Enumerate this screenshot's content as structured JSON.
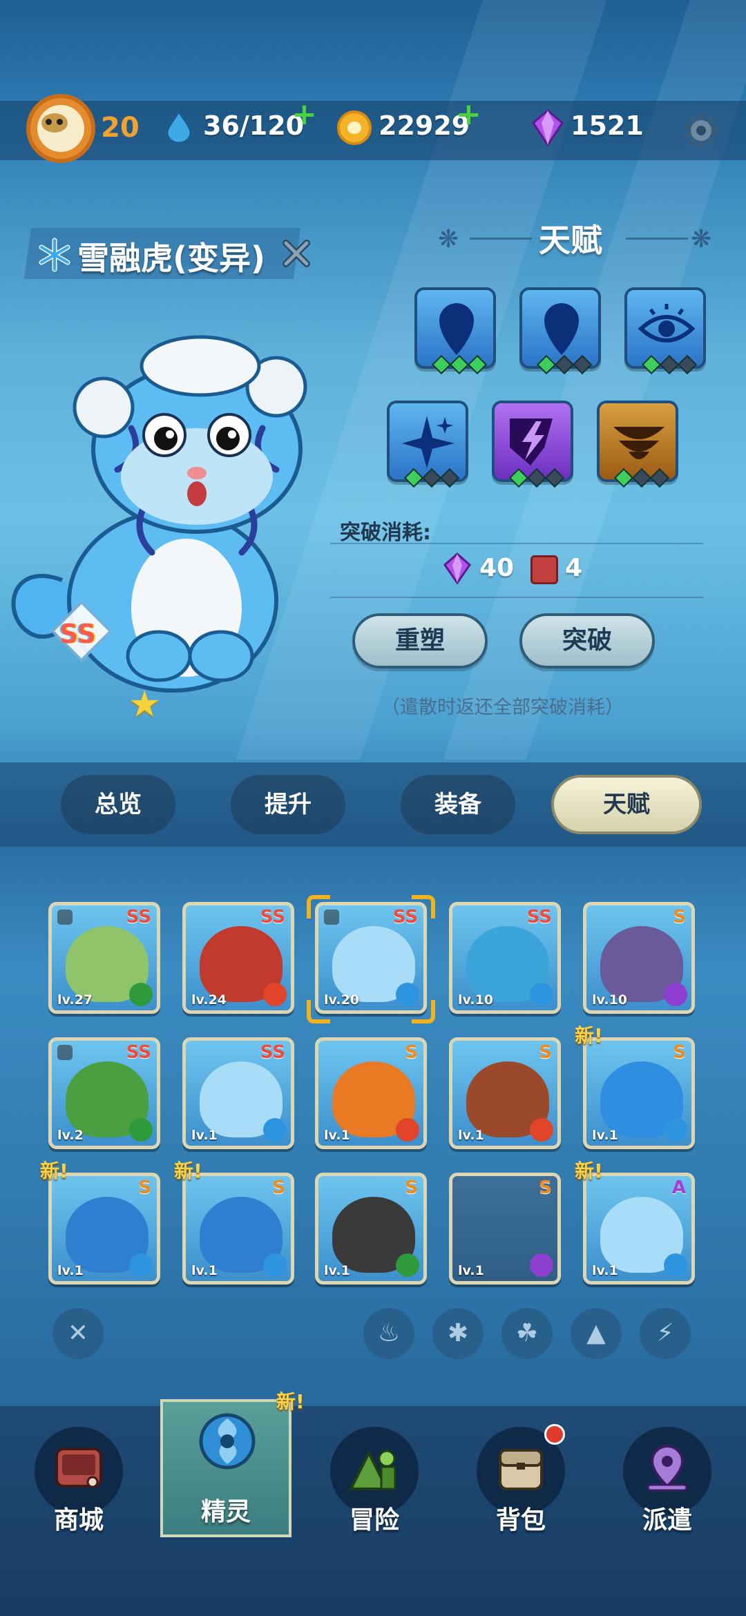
{
  "header": {
    "player_level": "20",
    "energy": "36/120",
    "coins": "22929",
    "gems": "1521"
  },
  "character": {
    "name": "雪融虎(变异)",
    "rank": "SS",
    "stars": "★"
  },
  "talent": {
    "title": "天赋",
    "skills": [
      {
        "color": "#2c74c8",
        "icon": "teardrop-icon",
        "level": 3
      },
      {
        "color": "#2c74c8",
        "icon": "teardrop-icon",
        "level": 1
      },
      {
        "color": "#2c74c8",
        "icon": "eye-icon",
        "level": 1
      },
      {
        "color": "#2c74c8",
        "icon": "sparkle-icon",
        "level": 1
      },
      {
        "color": "#6d2fc0",
        "icon": "lightning-shield-icon",
        "level": 1
      },
      {
        "color": "#9c5b14",
        "icon": "stacked-bowls-icon",
        "level": 1
      }
    ],
    "cost_label": "突破消耗:",
    "cost_gems": "40",
    "cost_books": "4",
    "reshape_label": "重塑",
    "breakthrough_label": "突破",
    "note": "（遣散时返还全部突破消耗）"
  },
  "tabs": [
    "总览",
    "提升",
    "装备",
    "天赋"
  ],
  "active_tab": "天赋",
  "roster": [
    {
      "level": "lv.27",
      "rank": "SS",
      "element": "leaf",
      "locked": true,
      "new": false,
      "color": "#8fc46a"
    },
    {
      "level": "lv.24",
      "rank": "SS",
      "element": "fire",
      "locked": false,
      "new": false,
      "color": "#c23a2e"
    },
    {
      "level": "lv.20",
      "rank": "SS",
      "element": "ice",
      "locked": true,
      "new": false,
      "color": "#a9dcf7"
    },
    {
      "level": "lv.10",
      "rank": "SS",
      "element": "ice",
      "locked": false,
      "new": false,
      "color": "#3ba4d8"
    },
    {
      "level": "lv.10",
      "rank": "S",
      "element": "bolt",
      "locked": false,
      "new": false,
      "color": "#6a5a9a"
    },
    {
      "level": "lv.2",
      "rank": "SS",
      "element": "leaf",
      "locked": true,
      "new": false,
      "color": "#4aa040"
    },
    {
      "level": "lv.1",
      "rank": "SS",
      "element": "ice",
      "locked": false,
      "new": false,
      "color": "#a9dcf7"
    },
    {
      "level": "lv.1",
      "rank": "S",
      "element": "fire",
      "locked": false,
      "new": false,
      "color": "#e77a22"
    },
    {
      "level": "lv.1",
      "rank": "S",
      "element": "fire",
      "locked": false,
      "new": false,
      "color": "#9a4a2a"
    },
    {
      "level": "lv.1",
      "rank": "S",
      "element": "ice",
      "locked": false,
      "new": true,
      "color": "#2e8fe0"
    },
    {
      "level": "lv.1",
      "rank": "S",
      "element": "ice",
      "locked": false,
      "new": true,
      "color": "#2f7fd0"
    },
    {
      "level": "lv.1",
      "rank": "S",
      "element": "ice",
      "locked": false,
      "new": true,
      "color": "#2f7fd0"
    },
    {
      "level": "lv.1",
      "rank": "S",
      "element": "leaf",
      "locked": false,
      "new": false,
      "color": "#3a3a3a"
    },
    {
      "level": "lv.1",
      "rank": "S",
      "element": "bolt",
      "locked": false,
      "new": false,
      "color": "",
      "empty": true
    },
    {
      "level": "lv.1",
      "rank": "A",
      "element": "ice",
      "locked": false,
      "new": true,
      "color": "#a9dcf7"
    }
  ],
  "new_tag": "新!",
  "filters": [
    "clear-filter-icon",
    "fire-filter-icon",
    "ice-filter-icon",
    "leaf-filter-icon",
    "earth-filter-icon",
    "bolt-filter-icon"
  ],
  "nav": {
    "items": [
      {
        "label": "商城",
        "icon": "shop-icon"
      },
      {
        "label": "精灵",
        "icon": "spirit-icon"
      },
      {
        "label": "冒险",
        "icon": "adventure-icon"
      },
      {
        "label": "背包",
        "icon": "backpack-icon"
      },
      {
        "label": "派遣",
        "icon": "dispatch-icon"
      }
    ],
    "active": "精灵",
    "spirit_new_tag": "新!"
  }
}
